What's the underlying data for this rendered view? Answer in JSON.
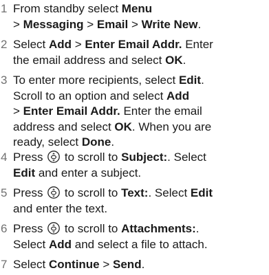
{
  "steps": [
    {
      "num": "1",
      "lines": [
        [
          {
            "t": "From standby select "
          },
          {
            "t": "Menu",
            "b": true
          }
        ],
        [
          {
            "t": "> "
          },
          {
            "t": "Messaging",
            "b": true
          },
          {
            "t": " > "
          },
          {
            "t": "Email",
            "b": true
          },
          {
            "t": " > "
          },
          {
            "t": "Write New",
            "b": true
          },
          {
            "t": "."
          }
        ]
      ]
    },
    {
      "num": "2",
      "lines": [
        [
          {
            "t": "Select "
          },
          {
            "t": "Add",
            "b": true
          },
          {
            "t": " > "
          },
          {
            "t": "Enter Email Addr.",
            "b": true
          },
          {
            "t": " Enter"
          }
        ],
        [
          {
            "t": "the email address and select "
          },
          {
            "t": "OK",
            "b": true
          },
          {
            "t": "."
          }
        ]
      ]
    },
    {
      "num": "3",
      "lines": [
        [
          {
            "t": "To enter more recipients, select "
          },
          {
            "t": "Edit",
            "b": true
          },
          {
            "t": "."
          }
        ],
        [
          {
            "t": "Scroll to an option and select "
          },
          {
            "t": "Add",
            "b": true
          }
        ],
        [
          {
            "t": "> "
          },
          {
            "t": "Enter Email Addr.",
            "b": true
          },
          {
            "t": " Enter the email"
          }
        ],
        [
          {
            "t": "address and select "
          },
          {
            "t": "OK",
            "b": true
          },
          {
            "t": ". When you are"
          }
        ],
        [
          {
            "t": "ready, select "
          },
          {
            "t": "Done",
            "b": true
          },
          {
            "t": "."
          }
        ]
      ]
    },
    {
      "num": "4",
      "lines": [
        [
          {
            "t": "Press "
          },
          {
            "icon": "navigation-key-icon"
          },
          {
            "t": " to scroll to "
          },
          {
            "t": "Subject:",
            "b": true
          },
          {
            "t": ". Select"
          }
        ],
        [
          {
            "t": "Edit",
            "b": true
          },
          {
            "t": " and enter a subject."
          }
        ]
      ]
    },
    {
      "num": "5",
      "lines": [
        [
          {
            "t": "Press "
          },
          {
            "icon": "navigation-key-icon"
          },
          {
            "t": " to scroll to "
          },
          {
            "t": "Text:",
            "b": true
          },
          {
            "t": ". Select "
          },
          {
            "t": "Edit",
            "b": true
          }
        ],
        [
          {
            "t": "and enter the text."
          }
        ]
      ]
    },
    {
      "num": "6",
      "lines": [
        [
          {
            "t": "Press "
          },
          {
            "icon": "navigation-key-icon"
          },
          {
            "t": " to scroll to "
          },
          {
            "t": "Attachments:",
            "b": true
          },
          {
            "t": "."
          }
        ],
        [
          {
            "t": "Select "
          },
          {
            "t": "Add",
            "b": true
          },
          {
            "t": " and select a file to attach."
          }
        ]
      ]
    },
    {
      "num": "7",
      "lines": [
        [
          {
            "t": "Select "
          },
          {
            "t": "Continue",
            "b": true
          },
          {
            "t": " > "
          },
          {
            "t": "Send",
            "b": true
          },
          {
            "t": "."
          }
        ]
      ]
    }
  ]
}
